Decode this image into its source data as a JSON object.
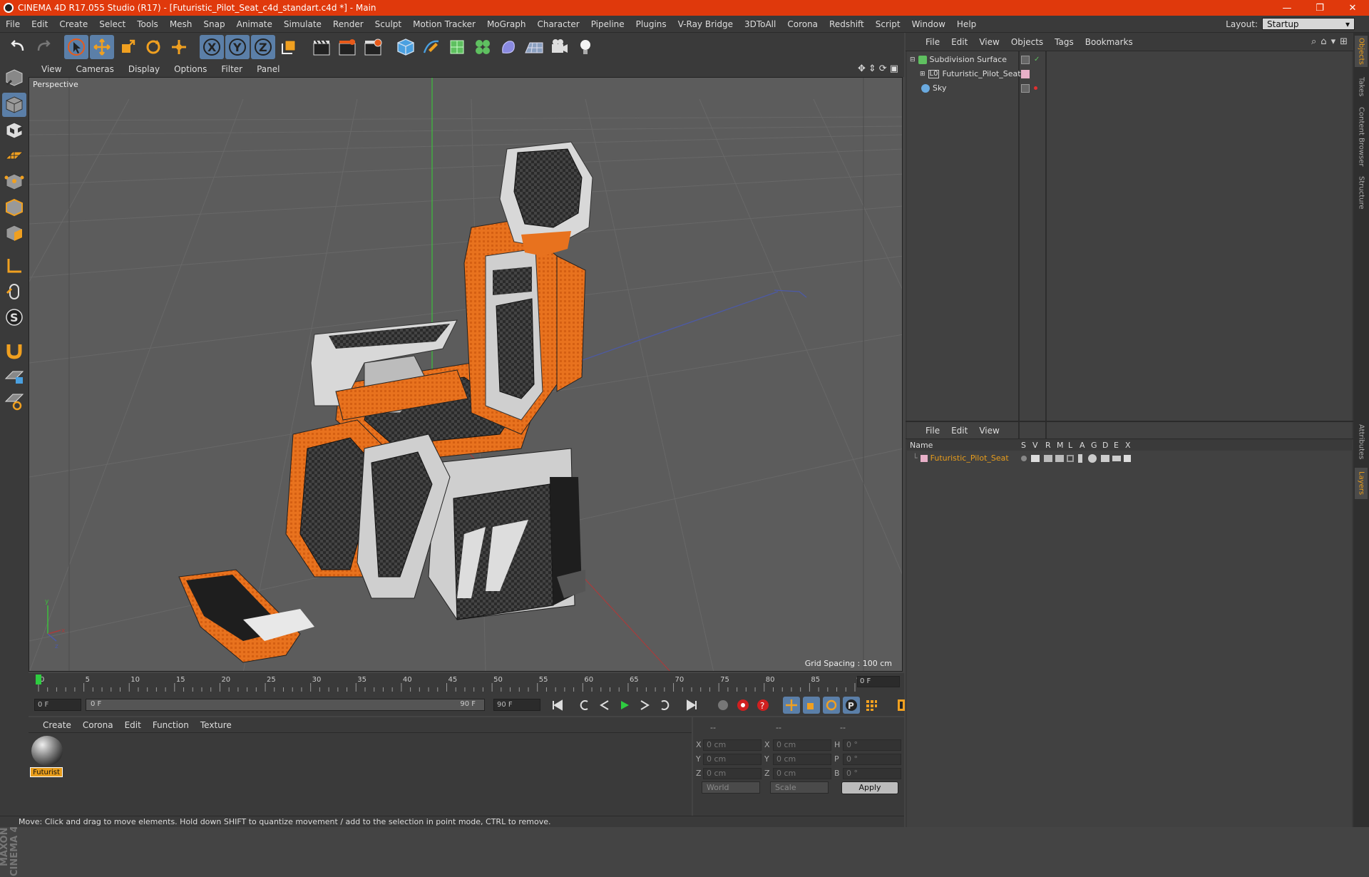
{
  "window": {
    "title": "CINEMA 4D R17.055 Studio (R17) - [Futuristic_Pilot_Seat_c4d_standart.c4d *] - Main",
    "minimize": "—",
    "restore": "❐",
    "close": "✕"
  },
  "menu": [
    "File",
    "Edit",
    "Create",
    "Select",
    "Tools",
    "Mesh",
    "Snap",
    "Animate",
    "Simulate",
    "Render",
    "Sculpt",
    "Motion Tracker",
    "MoGraph",
    "Character",
    "Pipeline",
    "Plugins",
    "V-Ray Bridge",
    "3DToAll",
    "Corona",
    "Redshift",
    "Script",
    "Window",
    "Help"
  ],
  "layout": {
    "label": "Layout:",
    "value": "Startup"
  },
  "viewport": {
    "menu": [
      "View",
      "Cameras",
      "Display",
      "Options",
      "Filter",
      "Panel"
    ],
    "camera": "Perspective",
    "grid_spacing": "Grid Spacing : 100 cm"
  },
  "timeline": {
    "ticks": [
      "0",
      "5",
      "10",
      "15",
      "20",
      "25",
      "30",
      "35",
      "40",
      "45",
      "50",
      "55",
      "60",
      "65",
      "70",
      "75",
      "80",
      "85",
      "90"
    ],
    "current_frame": "0 F"
  },
  "transport": {
    "start": "0 F",
    "range_start": "0 F",
    "range_end": "90 F",
    "end": "90 F"
  },
  "material": {
    "menu": [
      "Create",
      "Corona",
      "Edit",
      "Function",
      "Texture"
    ],
    "name": "Futurist"
  },
  "coords": {
    "headers": [
      "--",
      "--",
      "--"
    ],
    "rows": [
      {
        "l1": "X",
        "v1": "0 cm",
        "l2": "X",
        "v2": "0 cm",
        "l3": "H",
        "v3": "0 °"
      },
      {
        "l1": "Y",
        "v1": "0 cm",
        "l2": "Y",
        "v2": "0 cm",
        "l3": "P",
        "v3": "0 °"
      },
      {
        "l1": "Z",
        "v1": "0 cm",
        "l2": "Z",
        "v2": "0 cm",
        "l3": "B",
        "v3": "0 °"
      }
    ],
    "world": "World",
    "scale": "Scale",
    "apply": "Apply"
  },
  "status": "Move: Click and drag to move elements. Hold down SHIFT to quantize movement / add to the selection in point mode, CTRL to remove.",
  "objects": {
    "menu": [
      "File",
      "Edit",
      "View",
      "Objects",
      "Tags",
      "Bookmarks"
    ],
    "items": [
      {
        "name": "Subdivision Surface"
      },
      {
        "name": "Futuristic_Pilot_Seat"
      },
      {
        "name": "Sky"
      }
    ]
  },
  "layers": {
    "menu": [
      "File",
      "Edit",
      "View"
    ],
    "headers": [
      "Name",
      "S",
      "V",
      "R",
      "M",
      "L",
      "A",
      "G",
      "D",
      "E",
      "X"
    ],
    "items": [
      {
        "name": "Futuristic_Pilot_Seat"
      }
    ]
  },
  "sidetabs": [
    "Objects",
    "Takes",
    "Content Browser",
    "Structure",
    "Attributes",
    "Layers"
  ],
  "maxon": "MAXON CINEMA 4D",
  "colors": {
    "accent": "#e0390c",
    "selected": "#5b7fa8",
    "layer_orange": "#e89d1c"
  }
}
